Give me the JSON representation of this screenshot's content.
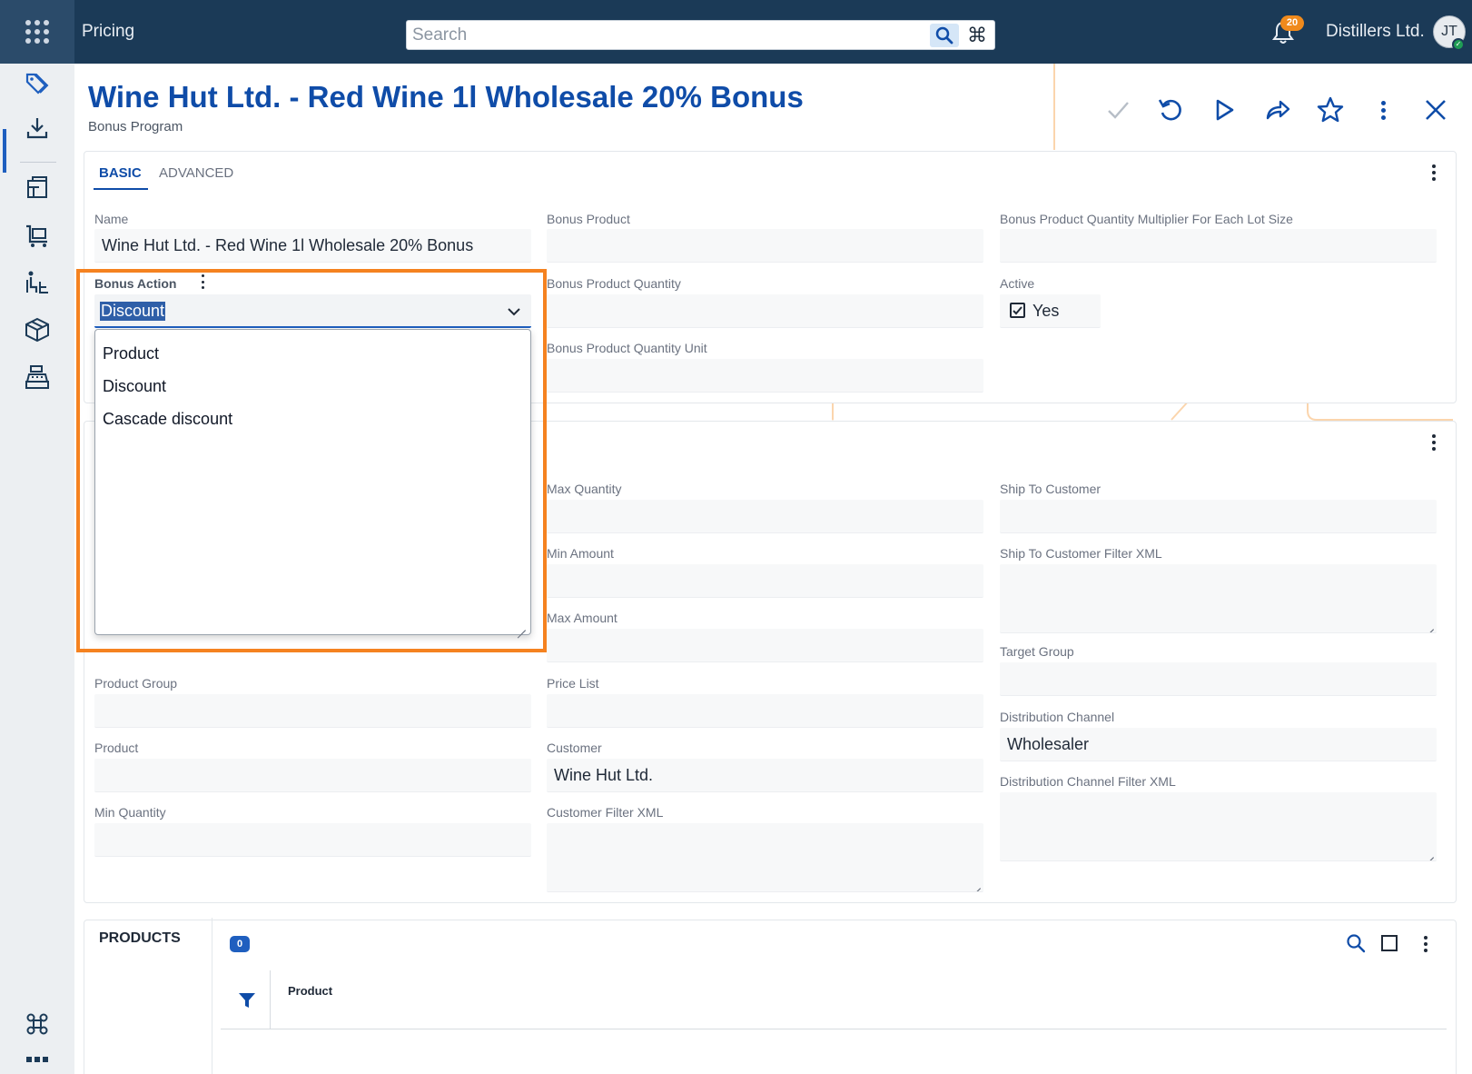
{
  "topbar": {
    "app_title": "Pricing",
    "search_placeholder": "Search",
    "notification_count": "20",
    "company": "Distillers Ltd.",
    "user_initials": "JT"
  },
  "nav": {
    "items": [
      "price-tag-icon",
      "download-icon",
      "catalog-icon",
      "cart-icon",
      "forklift-icon",
      "box-icon",
      "cash-register-icon"
    ],
    "bottom_items": [
      "command-icon",
      "more-icon"
    ]
  },
  "header": {
    "title": "Wine Hut Ltd. - Red Wine 1l Wholesale 20% Bonus",
    "subtitle": "Bonus Program"
  },
  "tabs": [
    {
      "label": "BASIC",
      "active": true
    },
    {
      "label": "ADVANCED",
      "active": false
    }
  ],
  "basic": {
    "name_label": "Name",
    "name_value": "Wine Hut Ltd. - Red Wine 1l Wholesale 20% Bonus",
    "bonus_action_label": "Bonus Action",
    "bonus_action_value": "Discount",
    "bonus_action_options": [
      "Product",
      "Discount",
      "Cascade discount"
    ],
    "bonus_product_label": "Bonus Product",
    "bonus_product_quantity_label": "Bonus Product Quantity",
    "bonus_product_quantity_unit_label": "Bonus Product Quantity Unit",
    "multiplier_label": "Bonus Product Quantity Multiplier For Each Lot Size",
    "active_label": "Active",
    "active_value": "Yes"
  },
  "criteria": {
    "max_quantity_label": "Max Quantity",
    "min_amount_label": "Min Amount",
    "max_amount_label": "Max Amount",
    "price_list_label": "Price List",
    "customer_label": "Customer",
    "customer_value": "Wine Hut Ltd.",
    "customer_filter_label": "Customer Filter XML",
    "product_group_label": "Product Group",
    "product_label": "Product",
    "min_quantity_label": "Min Quantity",
    "ship_to_label": "Ship To Customer",
    "ship_to_filter_label": "Ship To Customer Filter XML",
    "target_group_label": "Target Group",
    "distribution_channel_label": "Distribution Channel",
    "distribution_channel_value": "Wholesaler",
    "distribution_channel_filter_label": "Distribution Channel Filter XML"
  },
  "products": {
    "title": "PRODUCTS",
    "count": "0",
    "columns": [
      "Product"
    ]
  },
  "colors": {
    "topbar": "#1b3a57",
    "accent_blue": "#0f4ca8",
    "highlight_orange": "#f58220"
  }
}
